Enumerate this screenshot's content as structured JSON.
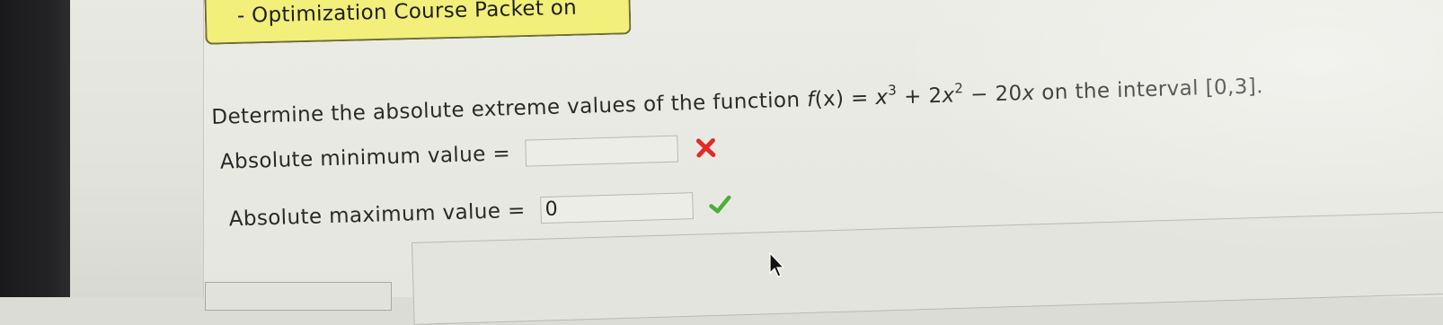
{
  "course_banner": {
    "text": "- Optimization Course Packet on"
  },
  "question": {
    "prefix": "Determine the absolute extreme values of the function ",
    "function_name": "f",
    "function_arg": "(x)",
    "equals": " = ",
    "term1_base": "x",
    "term1_exp": "3",
    "plus": " + 2",
    "term2_base": "x",
    "term2_exp": "2",
    "minus": " − 20",
    "term3_var": "x",
    "suffix": " on the interval [0,3]."
  },
  "answers": {
    "minimum": {
      "label": "Absolute minimum value =",
      "value": "",
      "status": "incorrect",
      "status_icon": "x-mark-icon",
      "status_color": "#e02b2b"
    },
    "maximum": {
      "label": "Absolute maximum value =",
      "value": "0",
      "status": "correct",
      "status_icon": "check-mark-icon",
      "status_color": "#4caf38"
    }
  },
  "colors": {
    "banner_bg": "#f2ef7a",
    "bezel": "#1e1e20",
    "page_bg": "#e6e6e0"
  }
}
